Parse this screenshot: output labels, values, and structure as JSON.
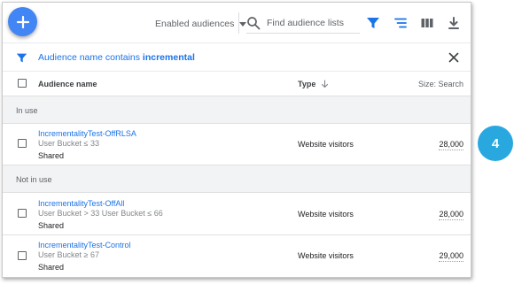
{
  "toolbar": {
    "add_label": "+",
    "audience_filter": "Enabled audiences",
    "search_placeholder": "Find audience lists"
  },
  "filter": {
    "prefix": "Audience name contains ",
    "term": "incremental"
  },
  "table": {
    "columns": {
      "name": "Audience name",
      "type": "Type",
      "size": "Size: Search"
    },
    "groups": [
      {
        "label": "In use",
        "rows": [
          {
            "name": "IncrementalityTest-OffRLSA",
            "rule": "User Bucket ≤ 33",
            "access": "Shared",
            "type": "Website visitors",
            "size": "28,000"
          }
        ]
      },
      {
        "label": "Not in use",
        "rows": [
          {
            "name": "IncrementalityTest-OffAll",
            "rule": "User Bucket > 33 User Bucket ≤ 66",
            "access": "Shared",
            "type": "Website visitors",
            "size": "28,000"
          },
          {
            "name": "IncrementalityTest-Control",
            "rule": "User Bucket ≥ 67",
            "access": "Shared",
            "type": "Website visitors",
            "size": "29,000"
          }
        ]
      }
    ]
  },
  "callout": {
    "number": "4"
  },
  "icons": {
    "add": "plus-icon",
    "dropdown": "caret-down-icon",
    "search": "search-icon",
    "filter": "filter-icon",
    "segment": "segment-icon",
    "columns": "columns-icon",
    "download": "download-icon",
    "close": "close-icon",
    "sort": "arrow-down-icon"
  },
  "colors": {
    "accent": "#4285f4",
    "link": "#1a73e8",
    "group_bg": "#f1f3f4",
    "callout": "#29a8e0"
  }
}
